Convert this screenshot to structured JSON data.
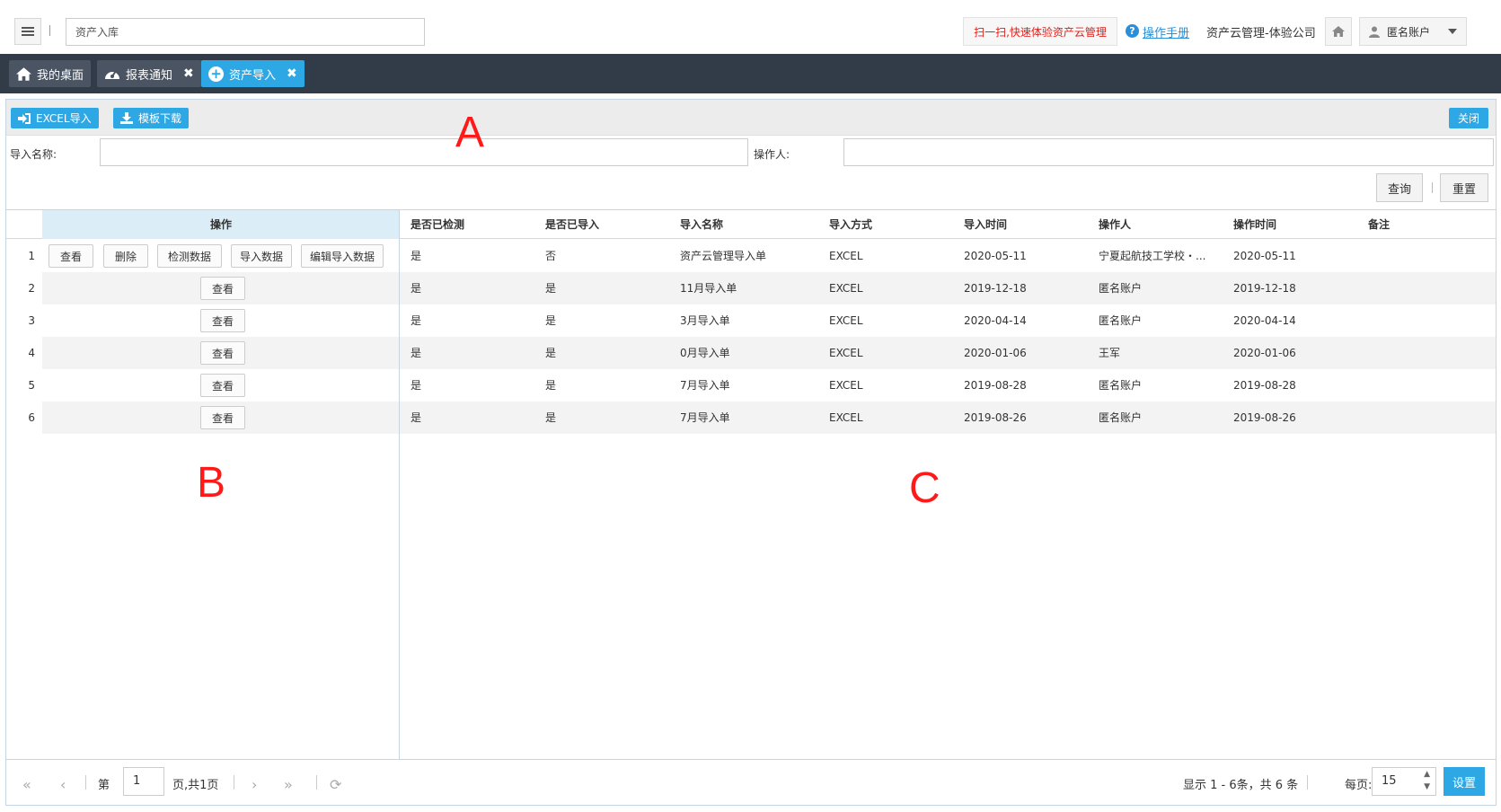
{
  "topbar": {
    "search_value": "资产入库",
    "promo_label": "扫一扫,快速体验资产云管理",
    "help_label": "操作手册",
    "company": "资产云管理-体验公司",
    "user_label": "匿名账户"
  },
  "tabs": [
    {
      "label": "我的桌面",
      "icon": "home-icon"
    },
    {
      "label": "报表通知",
      "icon": "dashboard-icon",
      "closable": true
    },
    {
      "label": "资产导入",
      "icon": "plus-circle-icon",
      "closable": true,
      "active": true
    }
  ],
  "toolbar": {
    "excel_import": "EXCEL导入",
    "template_download": "模板下载",
    "close": "关闭"
  },
  "filters": {
    "import_name_label": "导入名称:",
    "import_name_value": "",
    "operator_label": "操作人:",
    "operator_value": "",
    "query": "查询",
    "reset": "重置"
  },
  "table": {
    "op_header": "操作",
    "columns": [
      "是否已检测",
      "是否已导入",
      "导入名称",
      "导入方式",
      "导入时间",
      "操作人",
      "操作时间",
      "备注"
    ],
    "op_buttons_first": [
      "查看",
      "删除",
      "检测数据",
      "导入数据",
      "编辑导入数据"
    ],
    "op_button_view": "查看",
    "rows": [
      {
        "num": "1",
        "checked": "是",
        "imported": "否",
        "name": "资产云管理导入单",
        "method": "EXCEL",
        "time": "2020-05-11",
        "operator": "宁夏起航技工学校・...",
        "op_time": "2020-05-11",
        "remark": ""
      },
      {
        "num": "2",
        "checked": "是",
        "imported": "是",
        "name": "11月导入单",
        "method": "EXCEL",
        "time": "2019-12-18",
        "operator": "匿名账户",
        "op_time": "2019-12-18",
        "remark": ""
      },
      {
        "num": "3",
        "checked": "是",
        "imported": "是",
        "name": "3月导入单",
        "method": "EXCEL",
        "time": "2020-04-14",
        "operator": "匿名账户",
        "op_time": "2020-04-14",
        "remark": ""
      },
      {
        "num": "4",
        "checked": "是",
        "imported": "是",
        "name": "0月导入单",
        "method": "EXCEL",
        "time": "2020-01-06",
        "operator": "王军",
        "op_time": "2020-01-06",
        "remark": ""
      },
      {
        "num": "5",
        "checked": "是",
        "imported": "是",
        "name": "7月导入单",
        "method": "EXCEL",
        "time": "2019-08-28",
        "operator": "匿名账户",
        "op_time": "2019-08-28",
        "remark": ""
      },
      {
        "num": "6",
        "checked": "是",
        "imported": "是",
        "name": "7月导入单",
        "method": "EXCEL",
        "time": "2019-08-26",
        "operator": "匿名账户",
        "op_time": "2019-08-26",
        "remark": ""
      }
    ]
  },
  "pager": {
    "page_prefix": "第",
    "page_value": "1",
    "page_suffix": "页,共1页",
    "summary": "显示 1 - 6条，共 6 条",
    "per_page_label": "每页:",
    "per_page_value": "15",
    "set": "设置"
  },
  "annotations": {
    "a": "A",
    "b": "B",
    "c": "C"
  },
  "colors": {
    "accent": "#2ea8e5",
    "tabbar": "#323c48",
    "promo": "#e0201b",
    "annotation": "#ff1a1a"
  }
}
